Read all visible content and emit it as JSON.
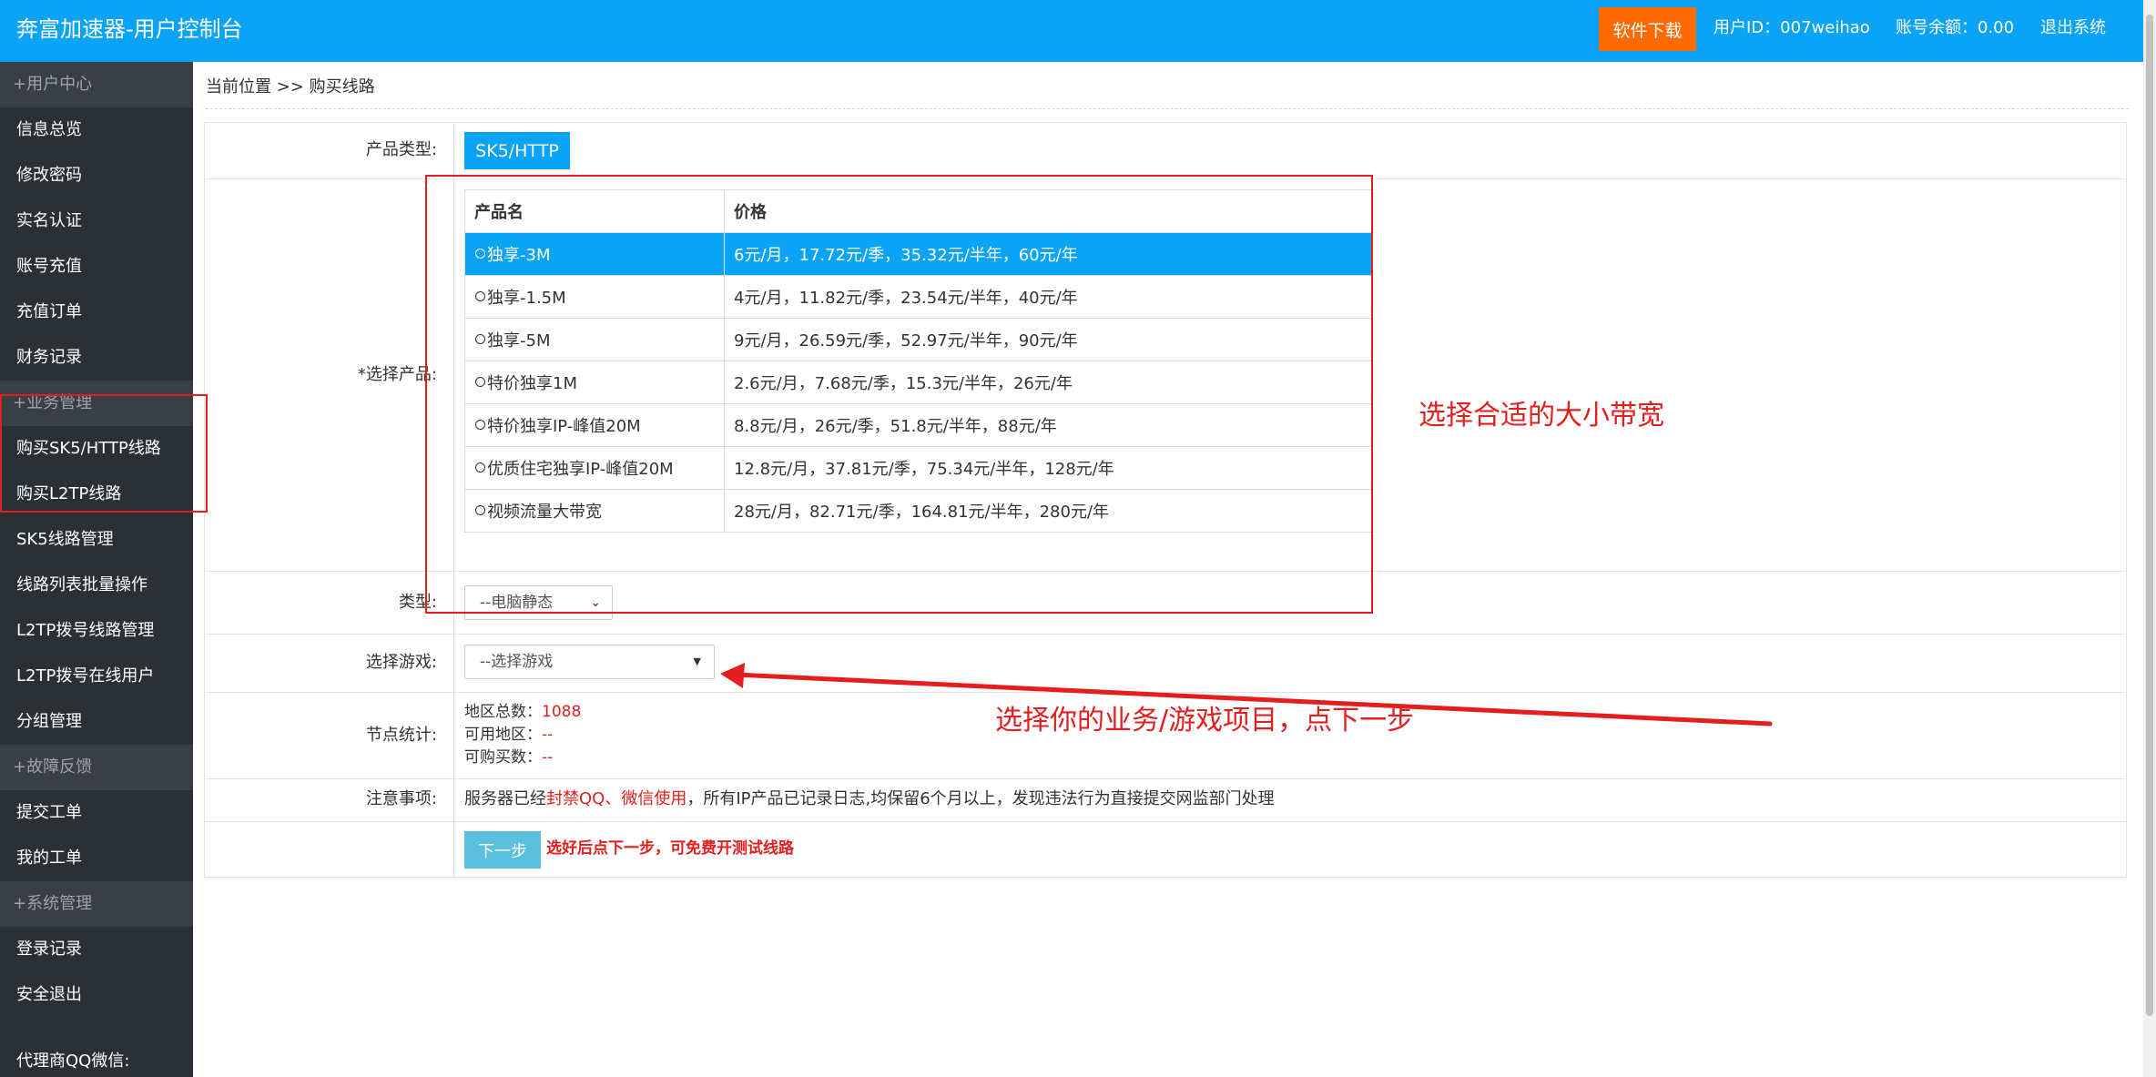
{
  "header": {
    "title": "奔富加速器-用户控制台",
    "download_label": "软件下载",
    "user_id": "用户ID：007weihao",
    "balance": "账号余额：0.00",
    "logout": "退出系统"
  },
  "sidebar": {
    "groups": [
      {
        "label": "+用户中心",
        "items": [
          "信息总览",
          "修改密码",
          "实名认证",
          "账号充值",
          "充值订单",
          "财务记录"
        ]
      },
      {
        "label": "+业务管理",
        "items": [
          "购买SK5/HTTP线路",
          "购买L2TP线路",
          "SK5线路管理",
          "线路列表批量操作",
          "L2TP拨号线路管理",
          "L2TP拨号在线用户",
          "分组管理"
        ]
      },
      {
        "label": "+故障反馈",
        "items": [
          "提交工单",
          "我的工单"
        ]
      },
      {
        "label": "+系统管理",
        "items": [
          "登录记录",
          "安全退出"
        ]
      }
    ],
    "footer": "代理商QQ微信:"
  },
  "breadcrumb": "当前位置 >> 购买线路",
  "form": {
    "product_type_label": "产品类型:",
    "product_type_value": "SK5/HTTP",
    "select_product_label": "*选择产品:",
    "table_headers": [
      "产品名",
      "价格"
    ],
    "products": [
      {
        "name": "独享-3M",
        "price": "6元/月，17.72元/季，35.32元/半年，60元/年",
        "selected": true
      },
      {
        "name": "独享-1.5M",
        "price": "4元/月，11.82元/季，23.54元/半年，40元/年",
        "selected": false
      },
      {
        "name": "独享-5M",
        "price": "9元/月，26.59元/季，52.97元/半年，90元/年",
        "selected": false
      },
      {
        "name": "特价独享1M",
        "price": "2.6元/月，7.68元/季，15.3元/半年，26元/年",
        "selected": false
      },
      {
        "name": "特价独享IP-峰值20M",
        "price": "8.8元/月，26元/季，51.8元/半年，88元/年",
        "selected": false
      },
      {
        "name": "优质住宅独享IP-峰值20M",
        "price": "12.8元/月，37.81元/季，75.34元/半年，128元/年",
        "selected": false
      },
      {
        "name": "视频流量大带宽",
        "price": "28元/月，82.71元/季，164.81元/半年，280元/年",
        "selected": false
      }
    ],
    "type_label": "类型:",
    "type_value": "--电脑静态",
    "game_label": "选择游戏:",
    "game_value": "--选择游戏",
    "node_label": "节点统计:",
    "node_total_label": "地区总数：",
    "node_total_value": "1088",
    "node_available_label": "可用地区：",
    "node_available_value": "--",
    "node_buyable_label": "可购买数：",
    "node_buyable_value": "--",
    "notice_label": "注意事项:",
    "notice_prefix": "服务器已经",
    "notice_red": "封禁QQ、微信使用",
    "notice_suffix": "，所有IP产品已记录日志,均保留6个月以上，发现违法行为直接提交网监部门处理",
    "next_label": "下一步",
    "next_hint": "选好后点下一步，可免费开测试线路"
  },
  "annotations": {
    "bandwidth": "选择合适的大小带宽",
    "game": "选择你的业务/游戏项目，点下一步"
  },
  "colors": {
    "header": "#0aa3f5",
    "sidebar": "#2b3034",
    "accent": "#ff6a00",
    "annotation": "#e41e1e"
  }
}
